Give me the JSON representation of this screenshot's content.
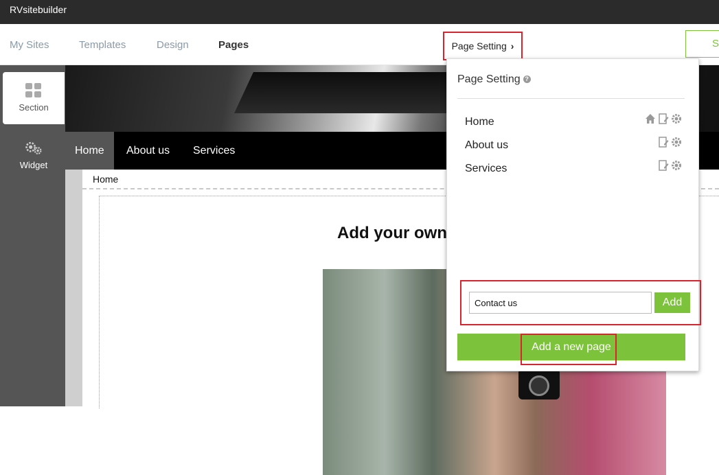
{
  "app": {
    "title": "RVsitebuilder"
  },
  "nav": {
    "items": [
      {
        "label": "My Sites"
      },
      {
        "label": "Templates"
      },
      {
        "label": "Design"
      },
      {
        "label": "Pages"
      }
    ],
    "page_setting_label": "Page Setting",
    "save_label": "S"
  },
  "sidebar": {
    "items": [
      {
        "label": "Section",
        "icon": "grid-icon"
      },
      {
        "label": "Widget",
        "icon": "gears-icon"
      }
    ]
  },
  "site": {
    "menu": [
      {
        "label": "Home"
      },
      {
        "label": "About us"
      },
      {
        "label": "Services"
      }
    ],
    "breadcrumb": "Home",
    "headline": "Add your own"
  },
  "page_setting_panel": {
    "title": "Page Setting",
    "pages": [
      {
        "label": "Home",
        "icons": [
          "home-icon",
          "edit-icon",
          "gear-icon"
        ]
      },
      {
        "label": "About us",
        "icons": [
          "edit-icon",
          "gear-icon"
        ]
      },
      {
        "label": "Services",
        "icons": [
          "edit-icon",
          "gear-icon"
        ]
      }
    ],
    "new_page_value": "Contact us",
    "add_label": "Add",
    "add_new_page_label": "Add a new page"
  },
  "colors": {
    "accent_green": "#7cc23a",
    "highlight_red": "#d9232e",
    "topbar": "#2b2b2b",
    "sidebar": "#555555"
  }
}
